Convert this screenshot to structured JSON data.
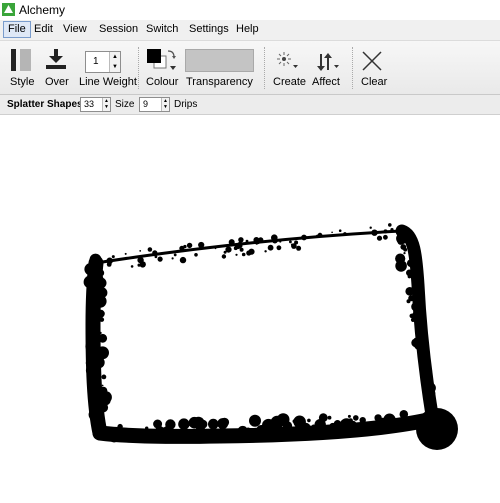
{
  "window": {
    "title": "Alchemy"
  },
  "menu": [
    "File",
    "Edit",
    "View",
    "Session",
    "Switch",
    "Settings",
    "Help"
  ],
  "toolbar": {
    "style_label": "Style",
    "over_label": "Over",
    "line_weight_label": "Line Weight",
    "line_weight_value": "1",
    "colour_label": "Colour",
    "transparency_label": "Transparency",
    "create_label": "Create",
    "affect_label": "Affect",
    "clear_label": "Clear"
  },
  "subtoolbar": {
    "mode_label": "Splatter Shapes",
    "shapes_value": "33",
    "size_label": "Size",
    "size_value": "9",
    "drips_label": "Drips"
  },
  "colors": {
    "ink": "#000000",
    "canvas": "#ffffff",
    "icon_green": "#3aa53a"
  }
}
